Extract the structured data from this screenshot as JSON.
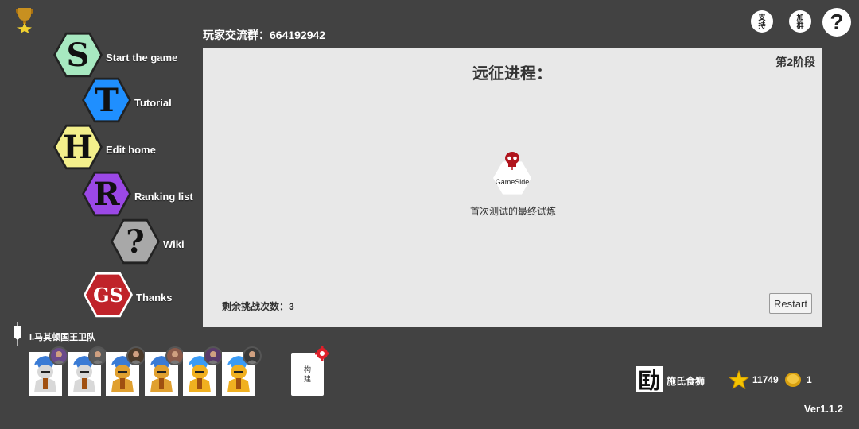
{
  "top_bar": {
    "group_label": "玩家交流群：664192942",
    "support_label": "支持",
    "join_group_label": "加群",
    "help_label": "?"
  },
  "menu": [
    {
      "letter": "S",
      "label": "Start the game",
      "color": "#a7e8c0"
    },
    {
      "letter": "T",
      "label": "Tutorial",
      "color": "#1f8fff"
    },
    {
      "letter": "H",
      "label": "Edit home",
      "color": "#f3ef8b"
    },
    {
      "letter": "R",
      "label": "Ranking list",
      "color": "#9b48e6"
    },
    {
      "letter": "?",
      "label": "Wiki",
      "color": "#a8a8a8"
    },
    {
      "letter": "GS",
      "label": "Thanks",
      "color": "#c0232a"
    }
  ],
  "panel": {
    "title": "远征进程：",
    "stage": "第2阶段",
    "node_text": "GameSide",
    "node_label": "首次测试的最终试炼",
    "remaining": "剩余挑战次数：3",
    "restart_label": "Restart"
  },
  "team": {
    "name": "I.马其顿国王卫队",
    "build_label": "构\n建",
    "cards": [
      {
        "helmet": "#d8d8d8",
        "plume": "#3a7bd5"
      },
      {
        "helmet": "#d8d8d8",
        "plume": "#3a7bd5"
      },
      {
        "helmet": "#e0a030",
        "plume": "#3a7bd5"
      },
      {
        "helmet": "#e0a030",
        "plume": "#3a7bd5"
      },
      {
        "helmet": "#f0b020",
        "plume": "#3a9bf5"
      },
      {
        "helmet": "#f0b020",
        "plume": "#3a9bf5"
      }
    ]
  },
  "player": {
    "icon_char": "劻",
    "name": "施氏食狮",
    "stars": "11749",
    "coins": "1"
  },
  "version": "Ver1.1.2",
  "colors": {
    "accent_red": "#b0141c",
    "panel_bg": "#e8e8e8",
    "page_bg": "#424242"
  }
}
